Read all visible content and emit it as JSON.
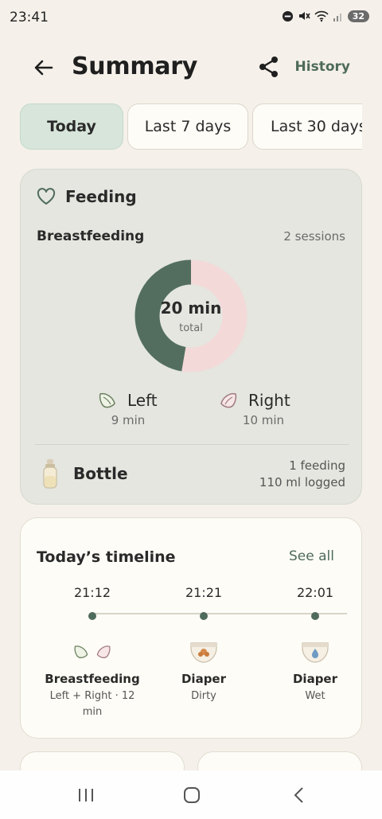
{
  "status": {
    "time": "23:41",
    "battery": "32"
  },
  "header": {
    "title": "Summary",
    "history_label": "History"
  },
  "tabs": [
    {
      "label": "Today",
      "active": true
    },
    {
      "label": "Last 7 days",
      "active": false
    },
    {
      "label": "Last 30 days",
      "active": false
    }
  ],
  "feeding": {
    "title": "Feeding",
    "breastfeeding_label": "Breastfeeding",
    "sessions": "2 sessions",
    "total_value": "20 min",
    "total_caption": "total",
    "left": {
      "label": "Left",
      "minutes": "9 min",
      "value": 9
    },
    "right": {
      "label": "Right",
      "minutes": "10 min",
      "value": 10
    },
    "bottle": {
      "label": "Bottle",
      "count": "1 feeding",
      "amount": "110 ml logged"
    }
  },
  "timeline": {
    "title": "Today’s timeline",
    "see_all": "See all",
    "events": [
      {
        "time": "21:12",
        "name": "Breastfeeding",
        "detail": "Left + Right · 12 min",
        "icon": "breast-pair-icon"
      },
      {
        "time": "21:21",
        "name": "Diaper",
        "detail": "Dirty",
        "icon": "diaper-dirty-icon"
      },
      {
        "time": "22:01",
        "name": "Diaper",
        "detail": "Wet",
        "icon": "diaper-wet-icon"
      }
    ]
  },
  "colors": {
    "accent": "#4f6b5b",
    "donut_left": "#536e5e",
    "donut_right": "#f3d9d8",
    "active_tab": "#d7e5db",
    "feeding_card": "#e4e6df",
    "background": "#f5f1ea"
  }
}
